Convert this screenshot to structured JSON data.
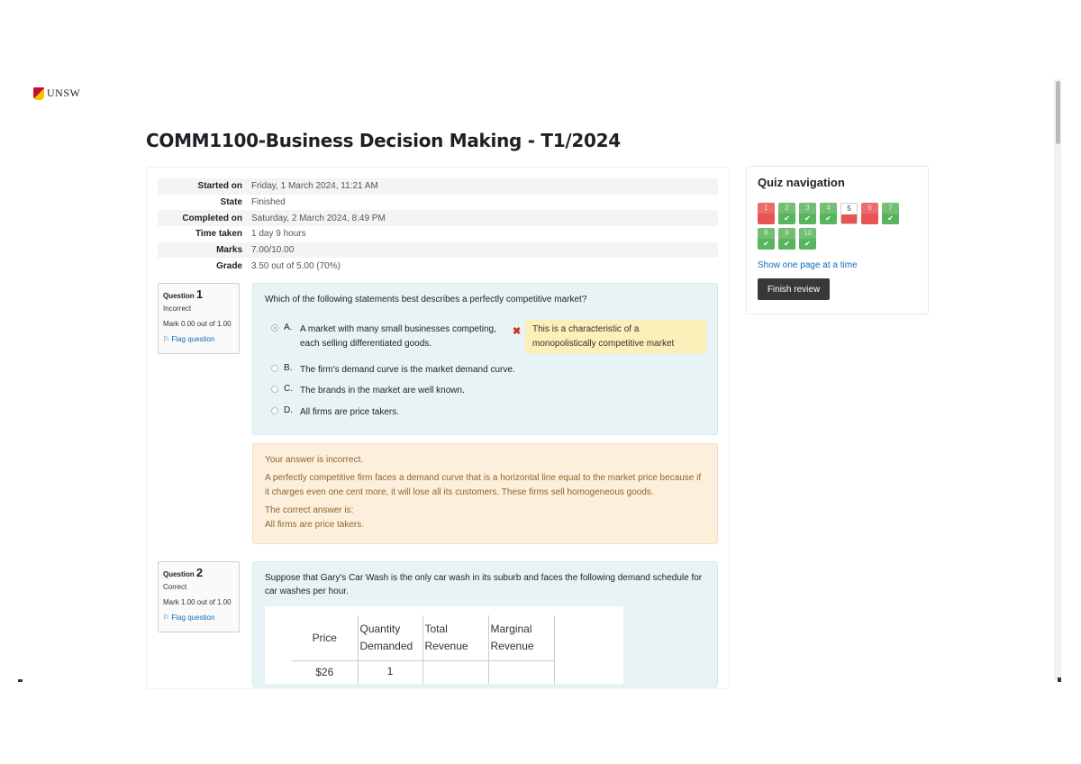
{
  "logo": {
    "text": "UNSW"
  },
  "page_title": "COMM1100-Business Decision Making - T1/2024",
  "summary": [
    {
      "label": "Started on",
      "value": "Friday, 1 March 2024, 11:21 AM"
    },
    {
      "label": "State",
      "value": "Finished"
    },
    {
      "label": "Completed on",
      "value": "Saturday, 2 March 2024, 8:49 PM"
    },
    {
      "label": "Time taken",
      "value": "1 day 9 hours"
    },
    {
      "label": "Marks",
      "value": "7.00/10.00"
    },
    {
      "label": "Grade",
      "value": "3.50 out of 5.00 (70%)"
    }
  ],
  "q1": {
    "label": "Question",
    "number": "1",
    "status": "Incorrect",
    "mark": "Mark 0.00 out of 1.00",
    "flag": "Flag question",
    "text": "Which of the following statements best describes a perfectly competitive market?",
    "options": [
      {
        "letter": "A.",
        "text": "A market with many small businesses competing, each selling differentiated goods."
      },
      {
        "letter": "B.",
        "text": "The firm's demand curve is the market demand curve."
      },
      {
        "letter": "C.",
        "text": "The brands in the market are well known."
      },
      {
        "letter": "D.",
        "text": "All firms are price takers."
      }
    ],
    "wrong_mark": "✖",
    "specific_feedback": "This is a characteristic of a monopolistically competitive market",
    "outcome": {
      "status": "Your answer is incorrect.",
      "general": " A perfectly competitive firm faces a demand curve that is a horizontal line equal to the market price because if it charges even one cent more, it will lose all its customers. These firms sell homogeneous goods.",
      "correct_label": "The correct answer is:",
      "correct_answer": "All firms are price takers."
    }
  },
  "q2": {
    "label": "Question",
    "number": "2",
    "status": "Correct",
    "mark": "Mark 1.00 out of 1.00",
    "flag": "Flag question",
    "text": "Suppose that Gary's Car Wash is the only car wash in its suburb and faces the following demand schedule for car washes per hour.",
    "table": {
      "headers": [
        "Price",
        "Quantity Demanded",
        "Total Revenue",
        "Marginal Revenue"
      ],
      "rows": [
        [
          "$26",
          "1",
          "",
          ""
        ]
      ]
    }
  },
  "quiz_nav": {
    "title": "Quiz navigation",
    "buttons": [
      {
        "num": "1",
        "state": "incorrect"
      },
      {
        "num": "2",
        "state": "correct"
      },
      {
        "num": "3",
        "state": "correct"
      },
      {
        "num": "4",
        "state": "correct"
      },
      {
        "num": "5",
        "state": "notanswered"
      },
      {
        "num": "6",
        "state": "incorrect"
      },
      {
        "num": "7",
        "state": "correct"
      },
      {
        "num": "8",
        "state": "correct"
      },
      {
        "num": "9",
        "state": "correct"
      },
      {
        "num": "10",
        "state": "correct"
      }
    ],
    "check_glyph": "✔",
    "show_one_page": "Show one page at a time",
    "finish_review": "Finish review"
  },
  "colors": {
    "correct": "#5ab35d",
    "incorrect": "#e85353",
    "link": "#0f6cbf",
    "feedback_bg": "#fcefdc",
    "question_bg": "#e7f3f5"
  }
}
